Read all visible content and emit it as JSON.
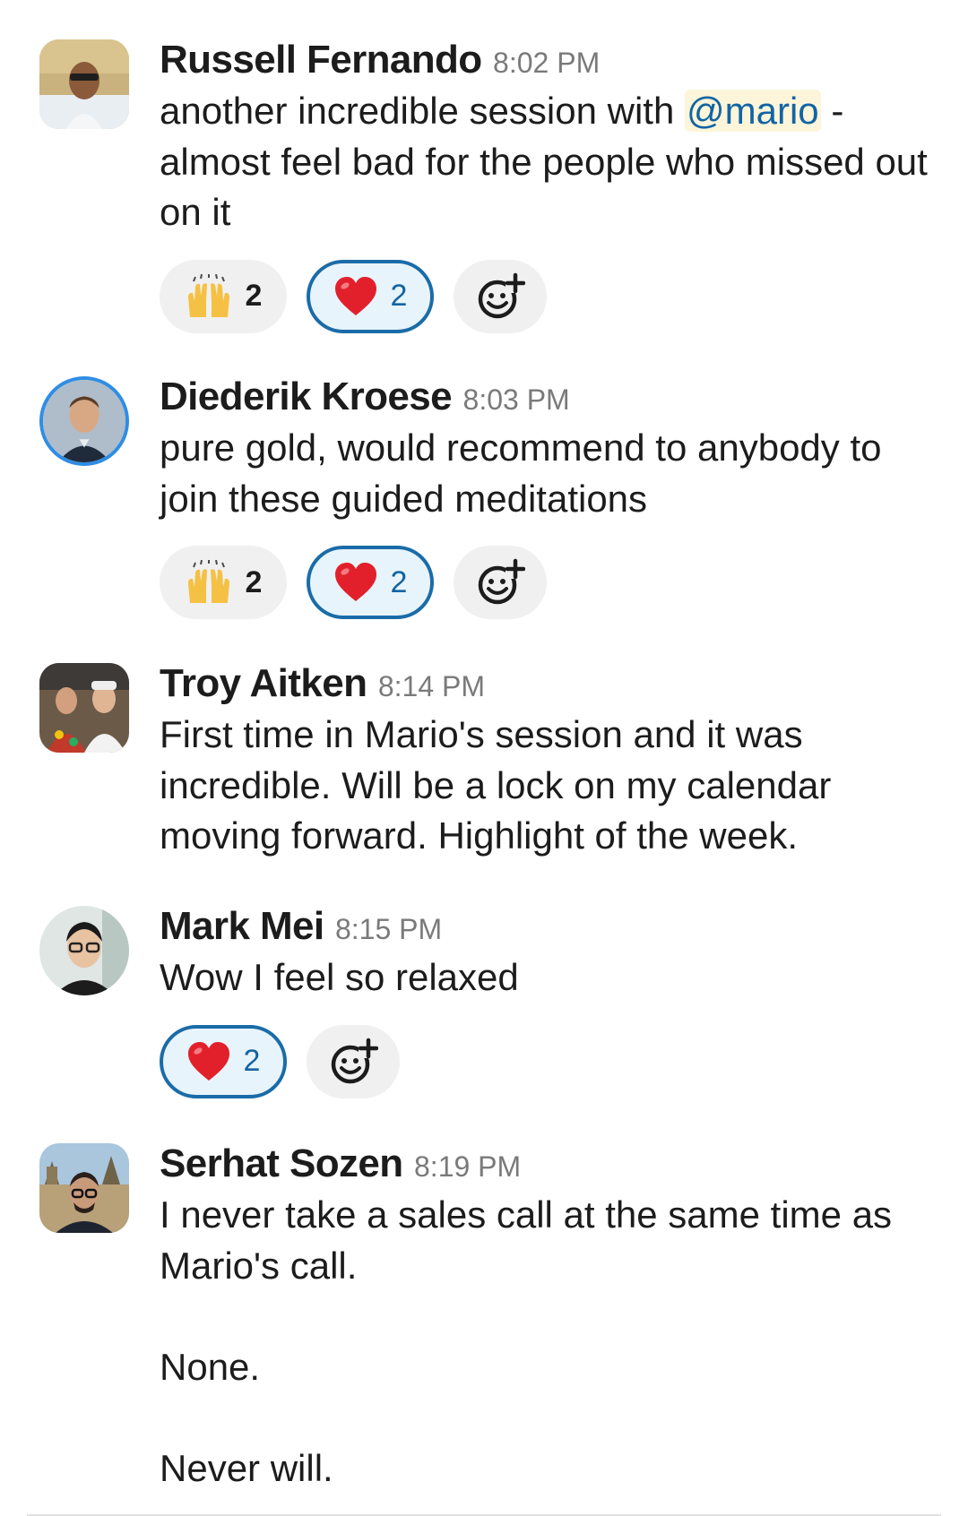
{
  "messages": [
    {
      "author": "Russell Fernando",
      "time": "8:02 PM",
      "avatar_icon": "avatar-photo",
      "text_parts": {
        "before": "another incredible session with ",
        "mention": "@mario",
        "after": " - almost feel bad for the people who missed out on it"
      },
      "reactions": [
        {
          "emoji": "raising-hands-emoji",
          "count": "2",
          "active": false
        },
        {
          "emoji": "red-heart-emoji",
          "count": "2",
          "active": true
        }
      ]
    },
    {
      "author": "Diederik Kroese",
      "time": "8:03 PM",
      "avatar_icon": "avatar-photo",
      "text": "pure gold, would recommend to anybody to join these guided meditations",
      "reactions": [
        {
          "emoji": "raising-hands-emoji",
          "count": "2",
          "active": false
        },
        {
          "emoji": "red-heart-emoji",
          "count": "2",
          "active": true
        }
      ]
    },
    {
      "author": "Troy Aitken",
      "time": "8:14 PM",
      "avatar_icon": "avatar-photo",
      "text": "First time in Mario's session and it was incredible. Will be a lock on my calendar moving forward. Highlight of the week."
    },
    {
      "author": "Mark Mei",
      "time": "8:15 PM",
      "avatar_icon": "avatar-photo",
      "text": "Wow I feel so relaxed",
      "reactions": [
        {
          "emoji": "red-heart-emoji",
          "count": "2",
          "active": true
        }
      ]
    },
    {
      "author": "Serhat Sozen",
      "time": "8:19 PM",
      "avatar_icon": "avatar-photo",
      "paragraphs": [
        "I never take a sales call at the same time as Mario's call.",
        "None.",
        "Never will."
      ]
    }
  ],
  "colors": {
    "mention_bg": "#fcf5da",
    "mention_text": "#1264a3",
    "active_reaction_border": "#1a6ca8",
    "active_reaction_bg": "#e8f4fb",
    "reaction_bg": "#f0f0f0"
  }
}
